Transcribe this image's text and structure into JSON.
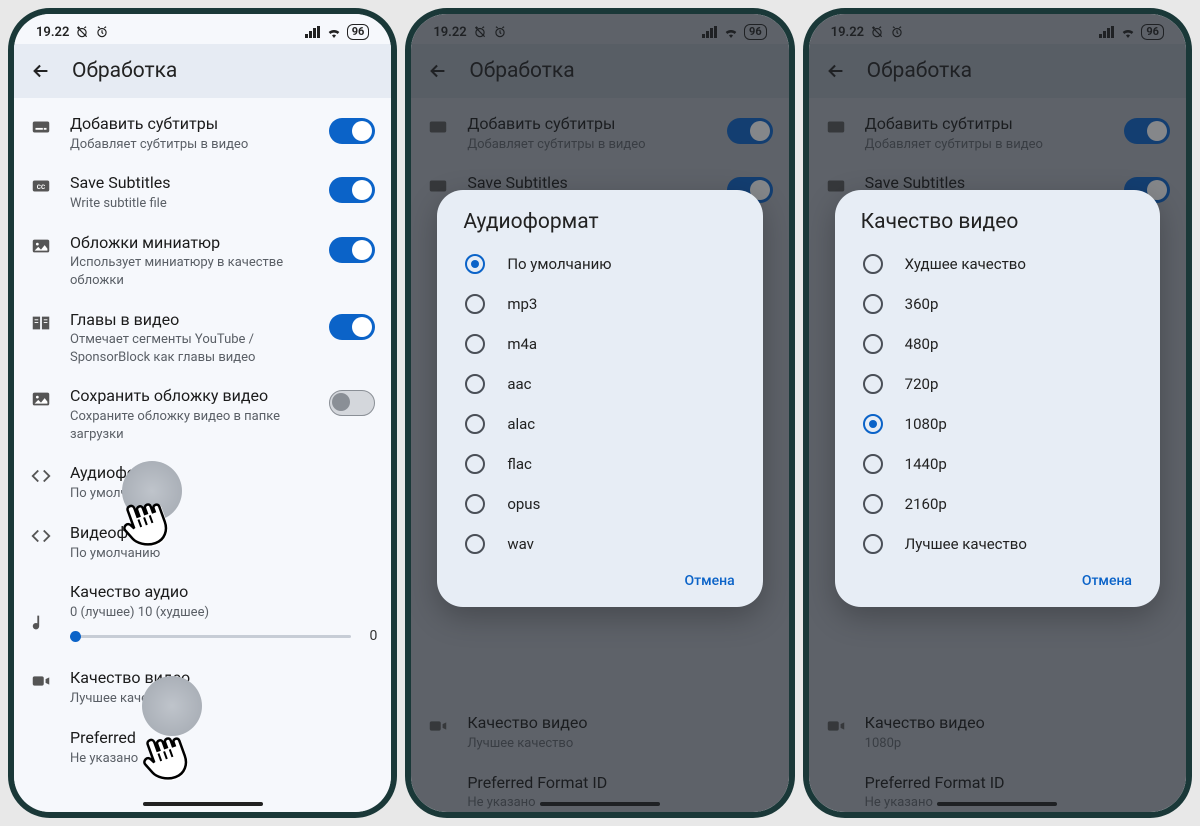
{
  "status": {
    "time": "19.22",
    "battery": "96"
  },
  "app": {
    "back_aria": "Назад",
    "title": "Обработка"
  },
  "settings": {
    "add_subtitles": {
      "title": "Добавить субтитры",
      "sub": "Добавляет субтитры в видео",
      "on": true
    },
    "save_subtitles": {
      "title": "Save Subtitles",
      "sub": "Write subtitle file",
      "on": true
    },
    "thumb_covers": {
      "title": "Обложки миниатюр",
      "sub": "Использует миниатюру в качестве обложки",
      "on": true
    },
    "chapters": {
      "title": "Главы в видео",
      "sub": "Отмечает сегменты YouTube / SponsorBlock как главы видео",
      "on": true
    },
    "save_cover": {
      "title": "Сохранить обложку видео",
      "sub": "Сохраните обложку видео в папке загрузки",
      "on": false
    },
    "audio_format": {
      "title": "Аудиоформат",
      "sub": "По умолчанию"
    },
    "video_format": {
      "title": "Видеоф",
      "sub": "По умолчанию"
    },
    "audio_quality": {
      "title": "Качество аудио",
      "sub": "0 (лучшее) 10 (худшее)",
      "value": "0"
    },
    "video_quality": {
      "title": "Качество видео",
      "sub_a": "Лучшее качество",
      "sub_c": "1080p"
    },
    "preferred_fmt": {
      "title": "Preferred Format ID",
      "title_short": "Preferred",
      "sub": "Не указано"
    }
  },
  "dialog_audio": {
    "title": "Аудиоформат",
    "cancel": "Отмена",
    "options": [
      "По умолчанию",
      "mp3",
      "m4a",
      "aac",
      "alac",
      "flac",
      "opus",
      "wav"
    ],
    "selected_index": 0
  },
  "dialog_video": {
    "title": "Качество видео",
    "cancel": "Отмена",
    "options": [
      "Худшее качество",
      "360p",
      "480p",
      "720p",
      "1080p",
      "1440p",
      "2160p",
      "Лучшее качество"
    ],
    "selected_index": 4
  }
}
